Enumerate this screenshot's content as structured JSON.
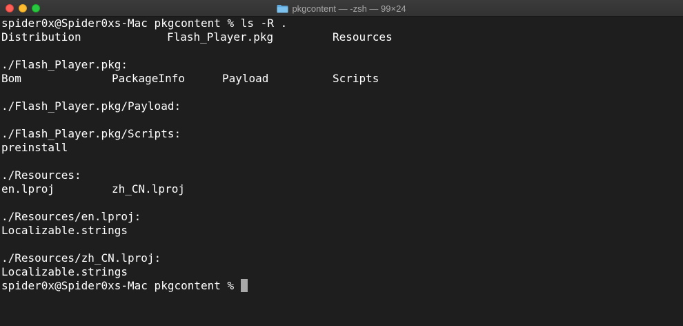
{
  "window": {
    "title": "pkgcontent — -zsh — 99×24",
    "folder_icon": "folder-icon",
    "colors": {
      "background": "#1e1e1e",
      "titlebar": "#353535",
      "text": "#ffffff",
      "cursor": "#a9a9a9",
      "close": "#fe5f57",
      "minimize": "#febc2e",
      "maximize": "#28c840"
    }
  },
  "terminal": {
    "prompt": "spider0x@Spider0xs-Mac pkgcontent % ",
    "command": "ls -R .",
    "root_listing": [
      "Distribution",
      "Flash_Player.pkg",
      "Resources"
    ],
    "flash_player_header": "./Flash_Player.pkg:",
    "flash_player_listing": [
      "Bom",
      "PackageInfo",
      "Payload",
      "Scripts"
    ],
    "payload_header": "./Flash_Player.pkg/Payload:",
    "scripts_header": "./Flash_Player.pkg/Scripts:",
    "scripts_listing": "preinstall",
    "resources_header": "./Resources:",
    "resources_listing": [
      "en.lproj",
      "zh_CN.lproj"
    ],
    "en_header": "./Resources/en.lproj:",
    "en_listing": "Localizable.strings",
    "zh_header": "./Resources/zh_CN.lproj:",
    "zh_listing": "Localizable.strings"
  }
}
